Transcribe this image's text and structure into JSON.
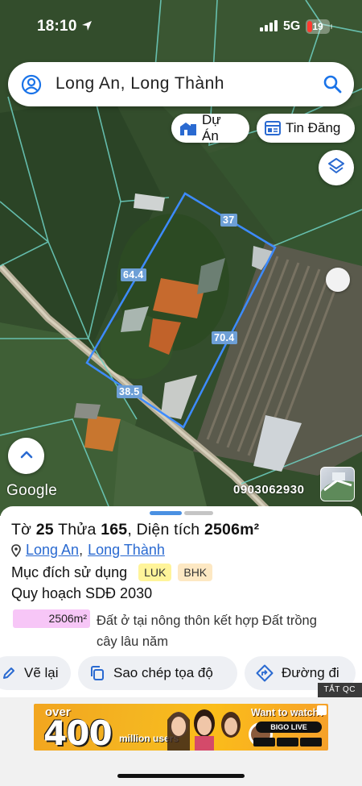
{
  "status_bar": {
    "time": "18:10",
    "network": "5G",
    "battery_level": "19"
  },
  "search": {
    "query": "Long An, Long Thành"
  },
  "chips": {
    "projects": "Dự Án",
    "listings": "Tin Đăng"
  },
  "map": {
    "measurements": {
      "top": "37",
      "left": "64.4",
      "right": "70.4",
      "bottom": "38.5"
    },
    "attribution": "Google",
    "phone_watermark": "0903062930"
  },
  "parcel": {
    "sheet_label": "Tờ",
    "sheet_no": "25",
    "lot_label": "Thửa",
    "lot_no": "165",
    "area_label": "Diện tích",
    "area_value": "2506m²",
    "province": "Long An",
    "separator": ",",
    "district": "Long Thành",
    "purpose_label": "Mục đích sử dụng",
    "purpose_tags": [
      "LUK",
      "BHK"
    ],
    "plan_label": "Quy hoạch SDĐ 2030",
    "plan_area": "2506m²",
    "plan_desc": "Đất ở tại nông thôn kết hợp Đất trồng cây lâu năm"
  },
  "actions": {
    "redraw": "Vẽ lại",
    "copy_coords": "Sao chép tọa độ",
    "directions": "Đường đi"
  },
  "ad": {
    "close_label": "TẮT QC",
    "over": "over",
    "number": "400",
    "users": "million users",
    "want": "Want to watch?",
    "brand": "BIGO LIVE"
  },
  "colors": {
    "link": "#2a6ad1",
    "parcel_border": "#3d8bff",
    "measure_label": "#6d9fd6",
    "luk_tag": "#fff49a",
    "bhk_tag": "#fde8c3",
    "area_badge": "#f7c6f7"
  }
}
